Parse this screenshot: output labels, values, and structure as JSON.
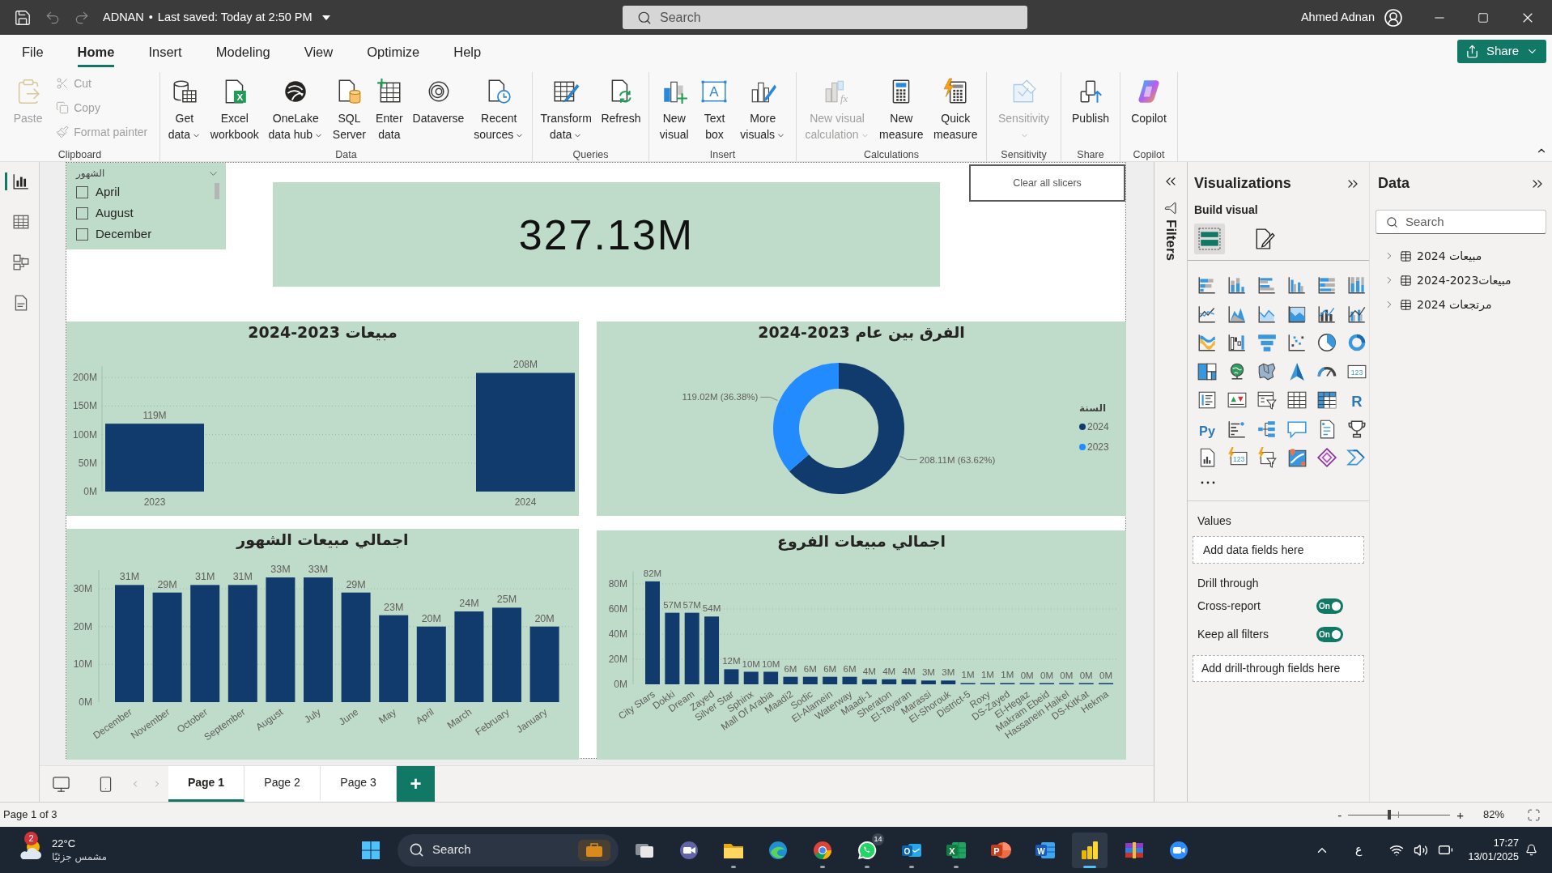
{
  "title_bar": {
    "quick_access": [
      {
        "disabled": false
      },
      {
        "disabled": true
      },
      {
        "disabled": true
      }
    ],
    "file_name": "ADNAN",
    "separator": "•",
    "saved": "Last saved: Today at 2:50 PM",
    "search_placeholder": "Search",
    "user": "Ahmed Adnan"
  },
  "menu_tabs": [
    {
      "label": "File",
      "selected": false
    },
    {
      "label": "Home",
      "selected": true
    },
    {
      "label": "Insert",
      "selected": false
    },
    {
      "label": "Modeling",
      "selected": false
    },
    {
      "label": "View",
      "selected": false
    },
    {
      "label": "Optimize",
      "selected": false
    },
    {
      "label": "Help",
      "selected": false
    }
  ],
  "share_button": "Share",
  "ribbon": {
    "groups": [
      {
        "label": "Clipboard",
        "buttons": [
          {
            "kind": "large",
            "label": [
              "Paste"
            ],
            "dropdown": false,
            "disabled": true
          },
          {
            "kind": "small",
            "label": [
              "Cut"
            ],
            "dropdown": false,
            "disabled": true
          },
          {
            "kind": "small",
            "label": [
              "Copy"
            ],
            "dropdown": false,
            "disabled": true
          },
          {
            "kind": "small",
            "label": [
              "Format painter"
            ],
            "dropdown": false,
            "disabled": true
          }
        ]
      },
      {
        "label": "Data",
        "buttons": [
          {
            "kind": "large",
            "label": [
              "Get",
              "data"
            ],
            "dropdown": true,
            "disabled": false
          },
          {
            "kind": "large",
            "label": [
              "Excel",
              "workbook"
            ],
            "glyph": "X",
            "dropdown": false,
            "disabled": false
          },
          {
            "kind": "large",
            "label": [
              "OneLake",
              "data hub"
            ],
            "dropdown": true,
            "disabled": false
          },
          {
            "kind": "large",
            "label": [
              "SQL",
              "Server"
            ],
            "dropdown": false,
            "disabled": false
          },
          {
            "kind": "large",
            "label": [
              "Enter",
              "data"
            ],
            "dropdown": false,
            "disabled": false
          },
          {
            "kind": "large",
            "label": [
              "Dataverse"
            ],
            "dropdown": false,
            "disabled": false
          },
          {
            "kind": "large",
            "label": [
              "Recent",
              "sources"
            ],
            "dropdown": true,
            "disabled": false
          }
        ]
      },
      {
        "label": "Queries",
        "buttons": [
          {
            "kind": "large",
            "label": [
              "Transform",
              "data"
            ],
            "dropdown": true,
            "disabled": false
          },
          {
            "kind": "large",
            "label": [
              "Refresh"
            ],
            "dropdown": false,
            "disabled": false
          }
        ]
      },
      {
        "label": "Insert",
        "buttons": [
          {
            "kind": "large",
            "label": [
              "New",
              "visual"
            ],
            "dropdown": false,
            "disabled": false
          },
          {
            "kind": "large",
            "label": [
              "Text",
              "box"
            ],
            "glyph": "A",
            "dropdown": false,
            "disabled": false
          },
          {
            "kind": "large",
            "label": [
              "More",
              "visuals"
            ],
            "dropdown": true,
            "disabled": false
          }
        ]
      },
      {
        "label": "Calculations",
        "buttons": [
          {
            "kind": "large",
            "label": [
              "New visual",
              "calculation"
            ],
            "glyph": "fx",
            "dropdown": true,
            "disabled": true
          },
          {
            "kind": "large",
            "label": [
              "New",
              "measure"
            ],
            "dropdown": false,
            "disabled": false
          },
          {
            "kind": "large",
            "label": [
              "Quick",
              "measure"
            ],
            "dropdown": false,
            "disabled": false
          }
        ]
      },
      {
        "label": "Sensitivity",
        "buttons": [
          {
            "kind": "large",
            "label": [
              "Sensitivity"
            ],
            "dropdown": true,
            "disabled": true
          }
        ]
      },
      {
        "label": "Share",
        "buttons": [
          {
            "kind": "large",
            "label": [
              "Publish"
            ],
            "dropdown": false,
            "disabled": false
          }
        ]
      },
      {
        "label": "Copilot",
        "buttons": [
          {
            "kind": "large",
            "label": [
              "Copilot"
            ],
            "dropdown": false,
            "disabled": false
          }
        ]
      }
    ]
  },
  "left_rail": {
    "views": [
      {
        "selected": true
      },
      {
        "selected": false
      },
      {
        "selected": false
      },
      {
        "selected": false
      }
    ]
  },
  "report": {
    "slicer": {
      "title": "الشهور",
      "items": [
        {
          "label": "April",
          "checked": false
        },
        {
          "label": "August",
          "checked": false
        },
        {
          "label": "December",
          "checked": false
        }
      ]
    },
    "card": {
      "value": "327.13M"
    },
    "clear_button": "Clear all slicers",
    "charts": [
      {
        "chart_data": {
          "type": "bar",
          "title": "مبيعات 2023-2024",
          "categories": [
            "2023",
            "2024"
          ],
          "values": [
            119,
            208
          ],
          "value_labels": [
            "119M",
            "208M"
          ],
          "yticks": [
            {
              "value": 0,
              "label": "0M"
            },
            {
              "value": 50,
              "label": "50M"
            },
            {
              "value": 100,
              "label": "100M"
            },
            {
              "value": 150,
              "label": "150M"
            },
            {
              "value": 200,
              "label": "200M"
            }
          ],
          "ylim": [
            0,
            220
          ],
          "color": "#123b6d",
          "grid": true
        }
      },
      {
        "chart_data": {
          "type": "donut",
          "title": "الفرق بين عام 2023-2024",
          "legend_title": "السنة",
          "categories": [
            "2024",
            "2023"
          ],
          "values": [
            208110000,
            119020000
          ],
          "colors": [
            "#123b6d",
            "#218bff"
          ],
          "value_labels": [
            "208.11M (63.62%)",
            "119.02M (36.38%)"
          ],
          "legend": "right"
        }
      },
      {
        "chart_data": {
          "type": "bar",
          "title": "اجمالي مبيعات الشهور",
          "categories": [
            "December",
            "November",
            "October",
            "September",
            "August",
            "July",
            "June",
            "May",
            "April",
            "March",
            "February",
            "January"
          ],
          "values": [
            31,
            29,
            31,
            31,
            33,
            33,
            29,
            23,
            20,
            24,
            25,
            20
          ],
          "value_labels": [
            "31M",
            "29M",
            "31M",
            "31M",
            "33M",
            "33M",
            "29M",
            "23M",
            "20M",
            "24M",
            "25M",
            "20M"
          ],
          "yticks": [
            {
              "value": 0,
              "label": "0M"
            },
            {
              "value": 10,
              "label": "10M"
            },
            {
              "value": 20,
              "label": "20M"
            },
            {
              "value": 30,
              "label": "30M"
            }
          ],
          "ylim": [
            0,
            35
          ],
          "color": "#123b6d",
          "grid": true
        }
      },
      {
        "chart_data": {
          "type": "bar",
          "title": "اجمالي مبيعات الفروع",
          "categories": [
            "City Stars",
            "Dokki",
            "Dream",
            "Zayed",
            "Silver Star",
            "Sphinx",
            "Mall Of Arabia",
            "Maadi2",
            "Sodic",
            "El-Alamein",
            "Waterway",
            "Maadi-1",
            "Sheraton",
            "El-Tayaran",
            "Marassi",
            "El-Shorouk",
            "District-5",
            "Roxy",
            "DS-Zayed",
            "El-Hegaz",
            "Makram Ebeid",
            "Hassanein Haikel",
            "DS-KitKat",
            "Hekma"
          ],
          "values": [
            82,
            57,
            57,
            54,
            12,
            10,
            10,
            6,
            6,
            6,
            6,
            4,
            4,
            4,
            3,
            3,
            1,
            1,
            1,
            0,
            0,
            0,
            0,
            0
          ],
          "value_labels": [
            "82M",
            "57M",
            "57M",
            "54M",
            "12M",
            "10M",
            "10M",
            "6M",
            "6M",
            "6M",
            "6M",
            "4M",
            "4M",
            "4M",
            "3M",
            "3M",
            "1M",
            "1M",
            "1M",
            "0M",
            "0M",
            "0M",
            "0M",
            "0M"
          ],
          "yticks": [
            {
              "value": 0,
              "label": "0M"
            },
            {
              "value": 20,
              "label": "20M"
            },
            {
              "value": 40,
              "label": "40M"
            },
            {
              "value": 60,
              "label": "60M"
            },
            {
              "value": 80,
              "label": "80M"
            }
          ],
          "ylim": [
            0,
            90
          ],
          "color": "#123b6d",
          "grid": true
        }
      }
    ]
  },
  "page_tabs": {
    "pages": [
      {
        "label": "Page 1",
        "selected": true
      },
      {
        "label": "Page 2",
        "selected": false
      },
      {
        "label": "Page 3",
        "selected": false
      }
    ],
    "add_label": "+"
  },
  "filters_pane": {
    "label": "Filters"
  },
  "visualizations": {
    "title": "Visualizations",
    "subtitle": "Build visual",
    "modes": [
      {
        "kind": "build",
        "selected": true
      },
      {
        "kind": "format",
        "selected": false
      }
    ],
    "gallery_glyphs": [
      "123",
      "R",
      "Py",
      "123"
    ],
    "wells": [
      {
        "label": "Values",
        "placeholder": "Add data fields here"
      }
    ],
    "drill_through": {
      "title": "Drill through",
      "toggles": [
        {
          "label": "Cross-report",
          "on": true,
          "state_text": "On"
        },
        {
          "label": "Keep all filters",
          "on": true,
          "state_text": "On"
        }
      ],
      "placeholder": "Add drill-through fields here"
    }
  },
  "data_pane": {
    "title": "Data",
    "search_placeholder": "Search",
    "tables": [
      {
        "name": "مبيعات 2024",
        "expanded": false
      },
      {
        "name": "مبيعات2023-2024",
        "expanded": false
      },
      {
        "name": "مرتجعات 2024",
        "expanded": false
      }
    ]
  },
  "status_bar": {
    "page_info": "Page 1 of 3",
    "zoom_out": "-",
    "zoom_in": "+",
    "zoom": {
      "level": 0.4
    },
    "zoom_reading": "82%"
  },
  "taskbar": {
    "weather": {
      "badge": "2",
      "temperature": "22°C",
      "condition": "مشمس جزئيًا"
    },
    "search_placeholder": "Search",
    "apps": [
      {
        "running": false,
        "selected": false
      },
      {
        "running": false,
        "selected": false
      },
      {
        "running": true,
        "selected": false
      },
      {
        "running": false,
        "selected": false
      },
      {
        "running": true,
        "selected": false
      },
      {
        "running": true,
        "selected": false,
        "badge": "14"
      },
      {
        "running": true,
        "selected": false,
        "glyph": "O"
      },
      {
        "running": true,
        "selected": false,
        "glyph": "X"
      },
      {
        "running": false,
        "selected": false,
        "glyph": "P"
      },
      {
        "running": false,
        "selected": false,
        "glyph": "W"
      },
      {
        "running": true,
        "selected": true
      },
      {
        "running": false,
        "selected": false
      },
      {
        "running": false,
        "selected": false
      }
    ],
    "language": "ع",
    "time": "17:27",
    "date": "13/01/2025"
  }
}
